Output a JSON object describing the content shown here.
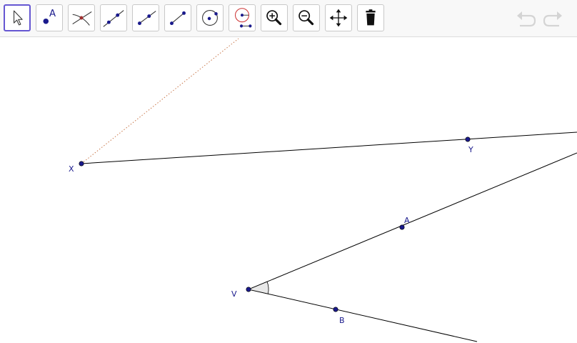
{
  "toolbar": {
    "tools": [
      {
        "name": "move",
        "icon": "arrow-cursor-icon",
        "active": true
      },
      {
        "name": "point",
        "icon": "point-icon",
        "icon_letter": "A"
      },
      {
        "name": "intersect",
        "icon": "intersect-icon"
      },
      {
        "name": "line",
        "icon": "line-through-points-icon"
      },
      {
        "name": "ray",
        "icon": "ray-icon"
      },
      {
        "name": "segment",
        "icon": "segment-icon"
      },
      {
        "name": "circle-center-point",
        "icon": "circle-center-point-icon"
      },
      {
        "name": "circle-center-radius",
        "icon": "circle-center-radius-icon"
      },
      {
        "name": "zoom-in",
        "icon": "zoom-in-icon"
      },
      {
        "name": "zoom-out",
        "icon": "zoom-out-icon"
      },
      {
        "name": "move-graphics-view",
        "icon": "move-arrows-icon"
      },
      {
        "name": "delete",
        "icon": "trash-icon"
      }
    ],
    "undo_icon": "undo-icon",
    "redo_icon": "redo-icon"
  },
  "points": {
    "X": "X",
    "Y": "Y",
    "A": "A",
    "V": "V",
    "B": "B"
  },
  "colors": {
    "point": "#1a1a8c",
    "line": "#000000",
    "dotted_line": "#c8774a",
    "active_tool_border": "#6557d2",
    "angle_fill": "#e8e8e8"
  }
}
